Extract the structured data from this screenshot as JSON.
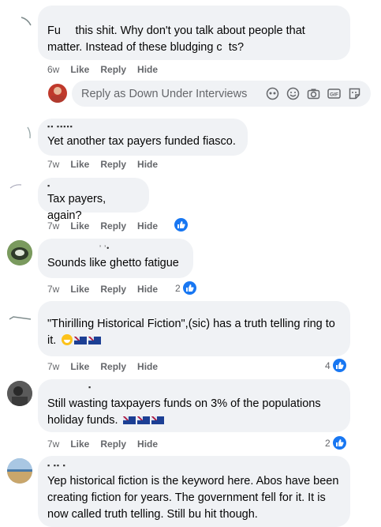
{
  "comments": [
    {
      "author": "",
      "text": "Fu  this shit. Why don't you talk about people that matter. Instead of these bludging c  ts?",
      "time": "6w",
      "like": "Like",
      "reply": "Reply",
      "hide": "Hide",
      "reactions": ""
    },
    {
      "author": "▪▪ ▪▪▪▪▪",
      "text": "Yet another tax payers funded fiasco.",
      "time": "7w",
      "like": "Like",
      "reply": "Reply",
      "hide": "Hide",
      "reactions": ""
    },
    {
      "author": "▪",
      "text": "Tax payers, again?",
      "time": "7w",
      "like": "Like",
      "reply": "Reply",
      "hide": "Hide",
      "reactions": ""
    },
    {
      "author": "’ ’•",
      "text": "Sounds like ghetto fatigue",
      "time": "7w",
      "like": "Like",
      "reply": "Reply",
      "hide": "Hide",
      "reactions": "2"
    },
    {
      "author": "",
      "text": "\"Thirilling Historical Fiction\",(sic) has a truth telling ring to it.",
      "time": "7w",
      "like": "Like",
      "reply": "Reply",
      "hide": "Hide",
      "reactions": "4"
    },
    {
      "author": "▪",
      "text": "Still wasting taxpayers funds on 3% of the populations holiday funds.",
      "time": "7w",
      "like": "Like",
      "reply": "Reply",
      "hide": "Hide",
      "reactions": "2"
    },
    {
      "author": "▪ ▪▪ ▪",
      "text": "Yep historical fiction is the keyword here. Abos have been creating fiction for years. The government fell for it. It is now called truth telling. Still bu hit though.",
      "time": "",
      "like": "",
      "reply": "",
      "hide": "",
      "reactions": ""
    }
  ],
  "reply_box": {
    "placeholder": "Reply as Down Under Interviews"
  },
  "icons": {
    "reply_tools": [
      "avatar-frame-icon",
      "smiley-icon",
      "camera-icon",
      "gif-icon",
      "sticker-icon"
    ],
    "reaction": "thumbs-up-icon"
  },
  "colors": {
    "bubble": "#f0f2f5",
    "muted": "#65676b",
    "like_blue": "#1877f2"
  }
}
